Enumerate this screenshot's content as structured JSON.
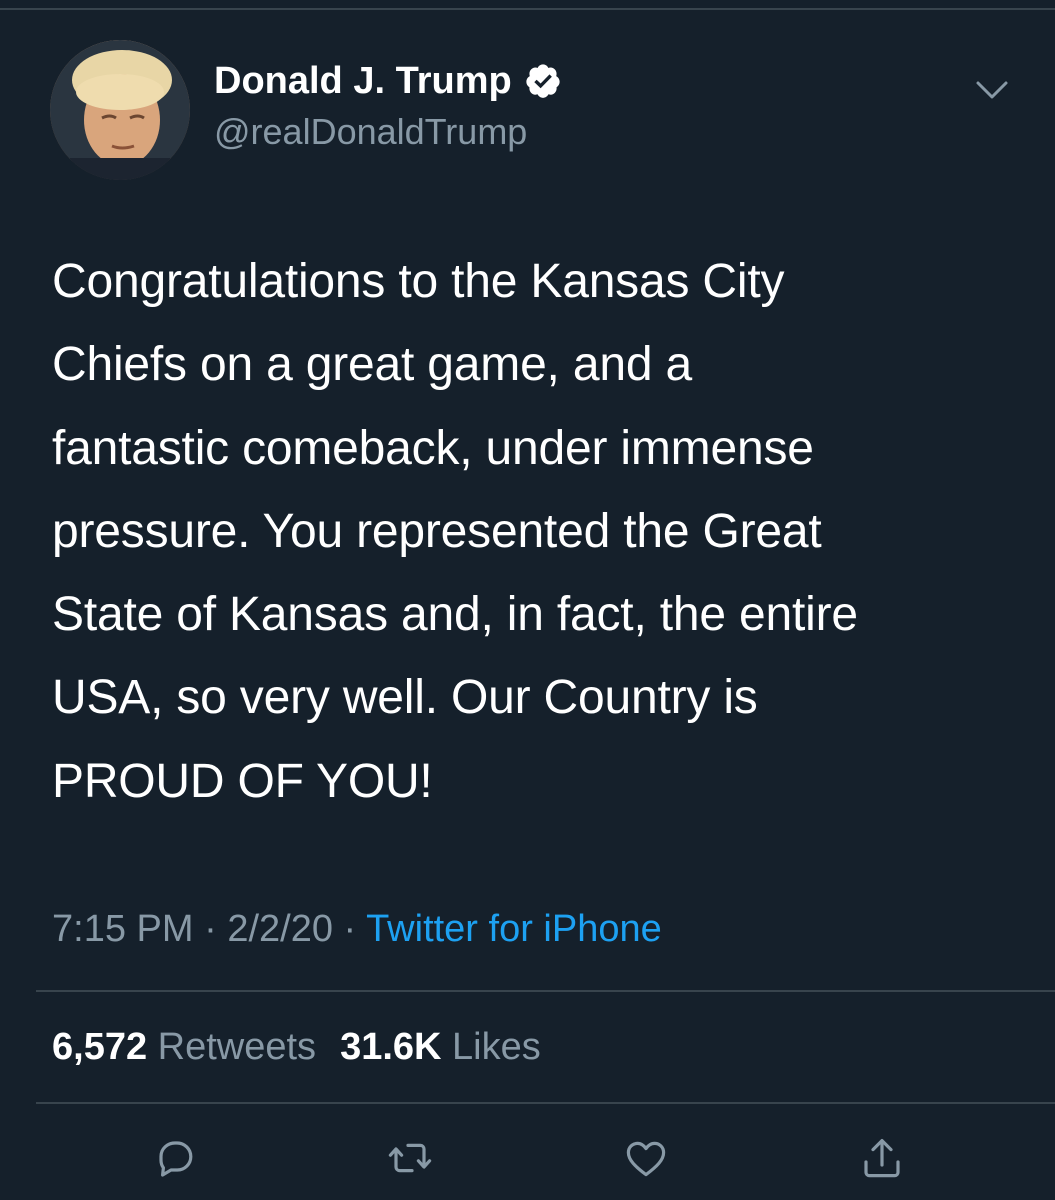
{
  "tweet": {
    "display_name": "Donald J. Trump",
    "handle": "@realDonaldTrump",
    "verified": true,
    "text_lines": [
      "Congratulations to the Kansas City",
      "Chiefs on a great game, and a",
      "fantastic comeback, under immense",
      "pressure. You represented the Great",
      "State of Kansas and, in fact, the entire",
      "USA, so very well. Our Country is",
      "PROUD OF YOU!"
    ],
    "time": "7:15 PM",
    "separator": " · ",
    "date": "2/2/20",
    "source": "Twitter for iPhone"
  },
  "stats": {
    "retweets_count": "6,572",
    "retweets_label": "Retweets",
    "likes_count": "31.6K",
    "likes_label": "Likes"
  },
  "icons": {
    "verified": "verified-badge-icon",
    "caret": "chevron-down-icon",
    "reply": "reply-icon",
    "retweet": "retweet-icon",
    "like": "heart-icon",
    "share": "share-icon"
  },
  "colors": {
    "background": "#15202b",
    "primary_text": "#ffffff",
    "secondary_text": "#8899a6",
    "link": "#1da1f2",
    "divider": "#38444d"
  }
}
